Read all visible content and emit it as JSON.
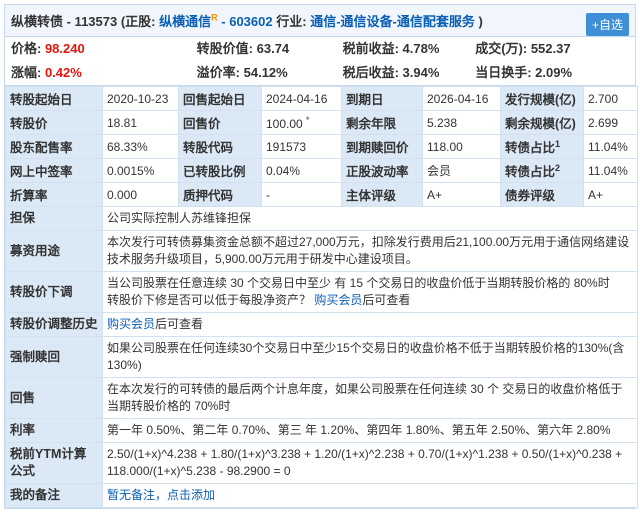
{
  "header": {
    "name_code": "纵横转债 - 113573",
    "stock_prefix": "(正股:",
    "stock_name": "纵横通信",
    "stock_badge": "R",
    "stock_code": "- 603602",
    "industry_label": "行业:",
    "industry": "通信-通信设备-通信配套服务",
    "close_paren": ")",
    "add_button": "+自选"
  },
  "quote": [
    {
      "label": "价格:",
      "value": "98.240",
      "red": true
    },
    {
      "label": "转股价值:",
      "value": "63.74",
      "red": false
    },
    {
      "label": "税前收益:",
      "value": "4.78%",
      "red": false
    },
    {
      "label": "成交(万):",
      "value": "552.37",
      "red": false
    },
    {
      "label": "涨幅:",
      "value": "0.42%",
      "red": true
    },
    {
      "label": "溢价率:",
      "value": "54.12%",
      "red": false
    },
    {
      "label": "税后收益:",
      "value": "3.94%",
      "red": false
    },
    {
      "label": "当日换手:",
      "value": "2.09%",
      "red": false
    }
  ],
  "grid_rows": [
    [
      [
        "转股起始日",
        "2020-10-23"
      ],
      [
        "回售起始日",
        "2024-04-16"
      ],
      [
        "到期日",
        "2026-04-16"
      ],
      [
        "发行规模(亿)",
        "2.700"
      ]
    ],
    [
      [
        "转股价",
        "18.81"
      ],
      [
        "回售价",
        "100.00 *"
      ],
      [
        "剩余年限",
        "5.238"
      ],
      [
        "剩余规模(亿)",
        "2.699"
      ]
    ],
    [
      [
        "股东配售率",
        "68.33%"
      ],
      [
        "转股代码",
        "191573"
      ],
      [
        "到期赎回价",
        "118.00"
      ],
      [
        "转债占比1",
        "11.04%"
      ]
    ],
    [
      [
        "网上中签率",
        "0.0015%"
      ],
      [
        "已转股比例",
        "0.04%"
      ],
      [
        "正股波动率",
        "会员"
      ],
      [
        "转债占比2",
        "11.04%"
      ]
    ],
    [
      [
        "折算率",
        "0.000"
      ],
      [
        "质押代码",
        "-"
      ],
      [
        "主体评级",
        "A+"
      ],
      [
        "债券评级",
        "A+"
      ]
    ]
  ],
  "long_rows": [
    {
      "label": "担保",
      "value": "公司实际控制人苏维锋担保"
    },
    {
      "label": "募资用途",
      "value": "本次发行可转债募集资金总额不超过27,000万元，扣除发行费用后21,100.00万元用于通信网络建设技术服务升级项目，5,900.00万元用于研发中心建设项目。"
    },
    {
      "label": "转股价下调",
      "value": "当公司股票在任意连续 30 个交易日中至少 有 15 个交易日的收盘价低于当期转股价格的 80%时",
      "value2": "转股价下修是否可以低于每股净资产？",
      "link": "购买会员",
      "suffix": "后可查看"
    },
    {
      "label": "转股价调整历史",
      "link": "购买会员",
      "suffix": "后可查看"
    },
    {
      "label": "强制赎回",
      "value": "如果公司股票在任何连续30个交易日中至少15个交易日的收盘价格不低于当期转股价格的130%(含130%)"
    },
    {
      "label": "回售",
      "value": "在本次发行的可转债的最后两个计息年度，如果公司股票在任何连续 30 个 交易日的收盘价格低于当期转股价格的 70%时"
    },
    {
      "label": "利率",
      "value": "第一年 0.50%、第二年 0.70%、第三 年 1.20%、第四年 1.80%、第五年 2.50%、第六年 2.80%"
    },
    {
      "label": "税前YTM计算公式",
      "value": "2.50/(1+x)^4.238 + 1.80/(1+x)^3.238 + 1.20/(1+x)^2.238 + 0.70/(1+x)^1.238 + 0.50/(1+x)^0.238 + 118.000/(1+x)^5.238 - 98.2900 = 0"
    },
    {
      "label": "我的备注",
      "link": "暂无备注，点击添加"
    }
  ]
}
